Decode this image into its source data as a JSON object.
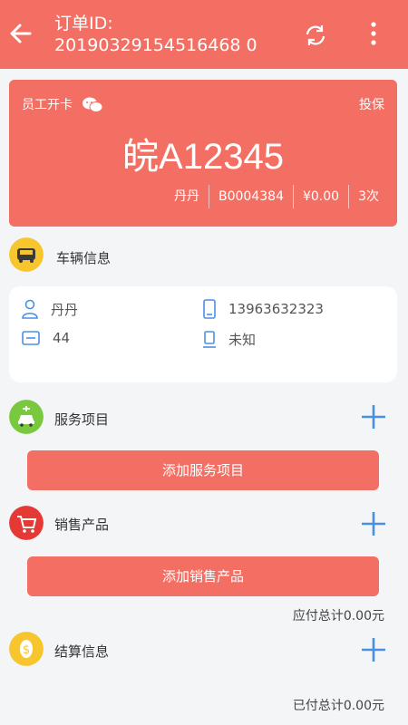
{
  "header": {
    "order_label": "订单ID:",
    "order_id": "20190329154516468 0"
  },
  "card": {
    "staff_label": "员工开卡",
    "insurance_label": "投保",
    "plate": "皖A12345",
    "owner": "丹丹",
    "card_no": "B0004384",
    "balance": "¥0.00",
    "count": "3次"
  },
  "vehicle": {
    "title": "车辆信息",
    "name": "丹丹",
    "phone": "13963632323",
    "card_value": "44",
    "device_value": "未知"
  },
  "service": {
    "title": "服务项目",
    "add_label": "添加服务项目"
  },
  "product": {
    "title": "销售产品",
    "add_label": "添加销售产品",
    "payable_total": "应付总计0.00元"
  },
  "settlement": {
    "title": "结算信息",
    "paid_total": "已付总计0.00元"
  },
  "colors": {
    "brand": "#f46f63",
    "plus": "#4a90e2",
    "icon_yellow": "#f7c52e",
    "icon_green": "#79c93f",
    "icon_red": "#e53935"
  }
}
